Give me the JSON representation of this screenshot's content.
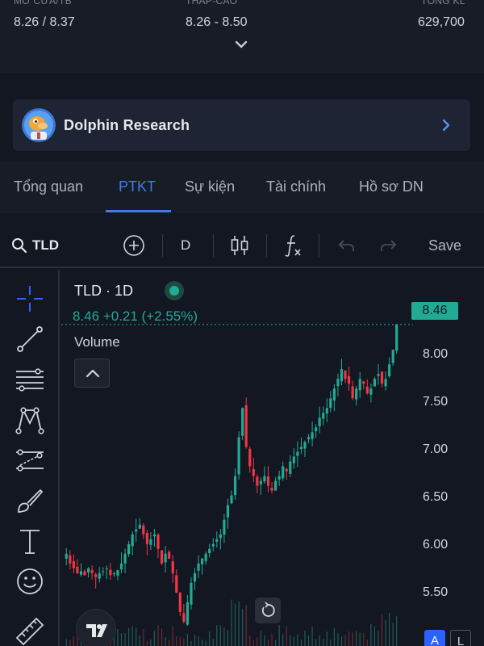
{
  "stats": [
    {
      "label": "MỞ CỬA/TB",
      "value": "8.26 / 8.37"
    },
    {
      "label": "THẤP-CAO",
      "value": "8.26 - 8.50"
    },
    {
      "label": "TỔNG KL",
      "value": "629,700"
    }
  ],
  "card": {
    "title": "Dolphin Research"
  },
  "tabs": [
    "Tổng quan",
    "PTKT",
    "Sự kiện",
    "Tài chính",
    "Hồ sơ DN"
  ],
  "active_tab": "PTKT",
  "toolbar": {
    "symbol": "TLD",
    "interval": "D",
    "save_label": "Save",
    "icons": [
      "search-icon",
      "add-symbol-icon",
      "candle-type-icon",
      "indicators-icon",
      "undo-icon",
      "redo-icon"
    ]
  },
  "drawing_tools": [
    "crosshair-icon",
    "trend-line-icon",
    "fib-lines-icon",
    "pattern-icon",
    "projection-icon",
    "brush-icon",
    "text-icon",
    "emoji-icon",
    "ruler-icon"
  ],
  "chart": {
    "legend_title": "TLD · 1D",
    "price_line": "8.46 +0.21 (+2.55%)",
    "volume_label": "Volume",
    "last_price": "8.46",
    "axis_labels": [
      "8.00",
      "7.50",
      "7.00",
      "6.50",
      "6.00",
      "5.50"
    ],
    "auto_label": "A",
    "log_label": "L",
    "logo_text": "TV"
  },
  "chart_data": {
    "type": "candlestick",
    "ylim": [
      5.3,
      8.6
    ],
    "y_ticks": [
      5.5,
      6.0,
      6.5,
      7.0,
      7.5,
      8.0
    ],
    "last": 8.46,
    "closes": [
      6.1,
      6.0,
      5.95,
      5.9,
      5.92,
      5.88,
      5.95,
      5.9,
      5.86,
      5.9,
      5.92,
      5.95,
      5.88,
      5.9,
      5.93,
      6.0,
      6.1,
      6.2,
      6.3,
      6.35,
      6.4,
      6.3,
      6.2,
      6.25,
      6.3,
      6.15,
      6.0,
      6.1,
      6.05,
      5.9,
      5.7,
      5.5,
      5.4,
      5.6,
      5.8,
      5.9,
      6.0,
      6.05,
      6.1,
      6.15,
      6.2,
      6.25,
      6.3,
      6.45,
      6.6,
      6.7,
      6.9,
      7.3,
      7.6,
      7.2,
      7.0,
      6.9,
      6.8,
      6.85,
      6.9,
      6.8,
      6.75,
      6.85,
      6.9,
      7.0,
      6.95,
      7.05,
      7.1,
      7.15,
      7.2,
      7.25,
      7.3,
      7.35,
      7.4,
      7.5,
      7.55,
      7.6,
      7.7,
      7.8,
      7.9,
      8.0,
      7.9,
      7.85,
      7.7,
      7.8,
      7.9,
      7.85,
      7.75,
      7.8,
      7.9,
      7.95,
      7.85,
      7.9,
      8.05,
      8.2,
      8.46
    ],
    "volume_hint": "bars along bottom"
  }
}
